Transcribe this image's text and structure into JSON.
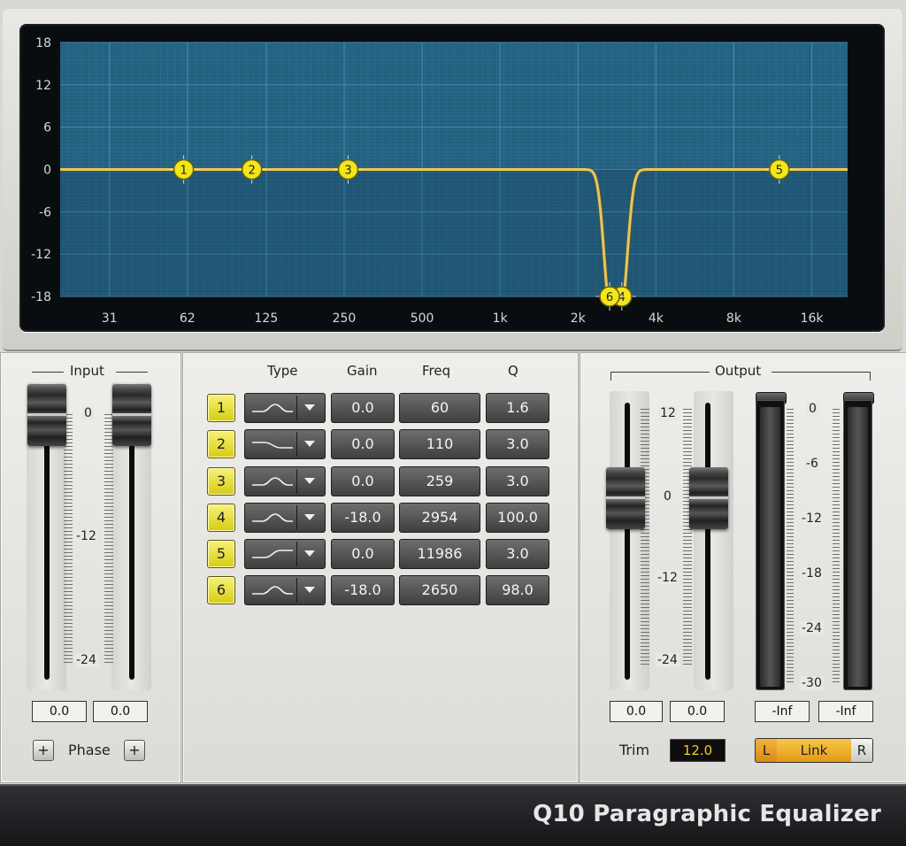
{
  "app": {
    "title": "Q10 Paragraphic Equalizer"
  },
  "graph": {
    "y_labels": [
      "18",
      "12",
      "6",
      "0",
      "-6",
      "-12",
      "-18"
    ],
    "x_labels": [
      "31",
      "62",
      "125",
      "250",
      "500",
      "1k",
      "2k",
      "4k",
      "8k",
      "16k"
    ],
    "markers": [
      "1",
      "2",
      "3",
      "4",
      "5",
      "6"
    ],
    "curve_color": "#e8c75a",
    "marker_color": "#f3e51a",
    "grid_bg": "#25607f"
  },
  "input": {
    "title": "Input",
    "scale": [
      "0",
      "-12",
      "-24"
    ],
    "left_value": "0.0",
    "right_value": "0.0",
    "phase_label": "Phase",
    "phase_left_button": "+",
    "phase_right_button": "+"
  },
  "bands": {
    "headers": {
      "type": "Type",
      "gain": "Gain",
      "freq": "Freq",
      "q": "Q"
    },
    "rows": [
      {
        "num": "1",
        "type_icon": "bell-filter-icon",
        "gain": "0.0",
        "freq": "60",
        "q": "1.6"
      },
      {
        "num": "2",
        "type_icon": "low-shelf-filter-icon",
        "gain": "0.0",
        "freq": "110",
        "q": "3.0"
      },
      {
        "num": "3",
        "type_icon": "bell-filter-icon",
        "gain": "0.0",
        "freq": "259",
        "q": "3.0"
      },
      {
        "num": "4",
        "type_icon": "bell-filter-icon",
        "gain": "-18.0",
        "freq": "2954",
        "q": "100.0"
      },
      {
        "num": "5",
        "type_icon": "high-shelf-filter-icon",
        "gain": "0.0",
        "freq": "11986",
        "q": "3.0"
      },
      {
        "num": "6",
        "type_icon": "bell-filter-icon",
        "gain": "-18.0",
        "freq": "2650",
        "q": "98.0"
      }
    ]
  },
  "output": {
    "title": "Output",
    "trim_scale": [
      "12",
      "0",
      "-12",
      "-24"
    ],
    "meter_scale": [
      "0",
      "-6",
      "-12",
      "-18",
      "-24",
      "-30"
    ],
    "left_value": "0.0",
    "right_value": "0.0",
    "meter_left": "-Inf",
    "meter_right": "-Inf",
    "trim_label": "Trim",
    "trim_value": "12.0",
    "link_left": "L",
    "link_label": "Link",
    "link_right": "R"
  }
}
